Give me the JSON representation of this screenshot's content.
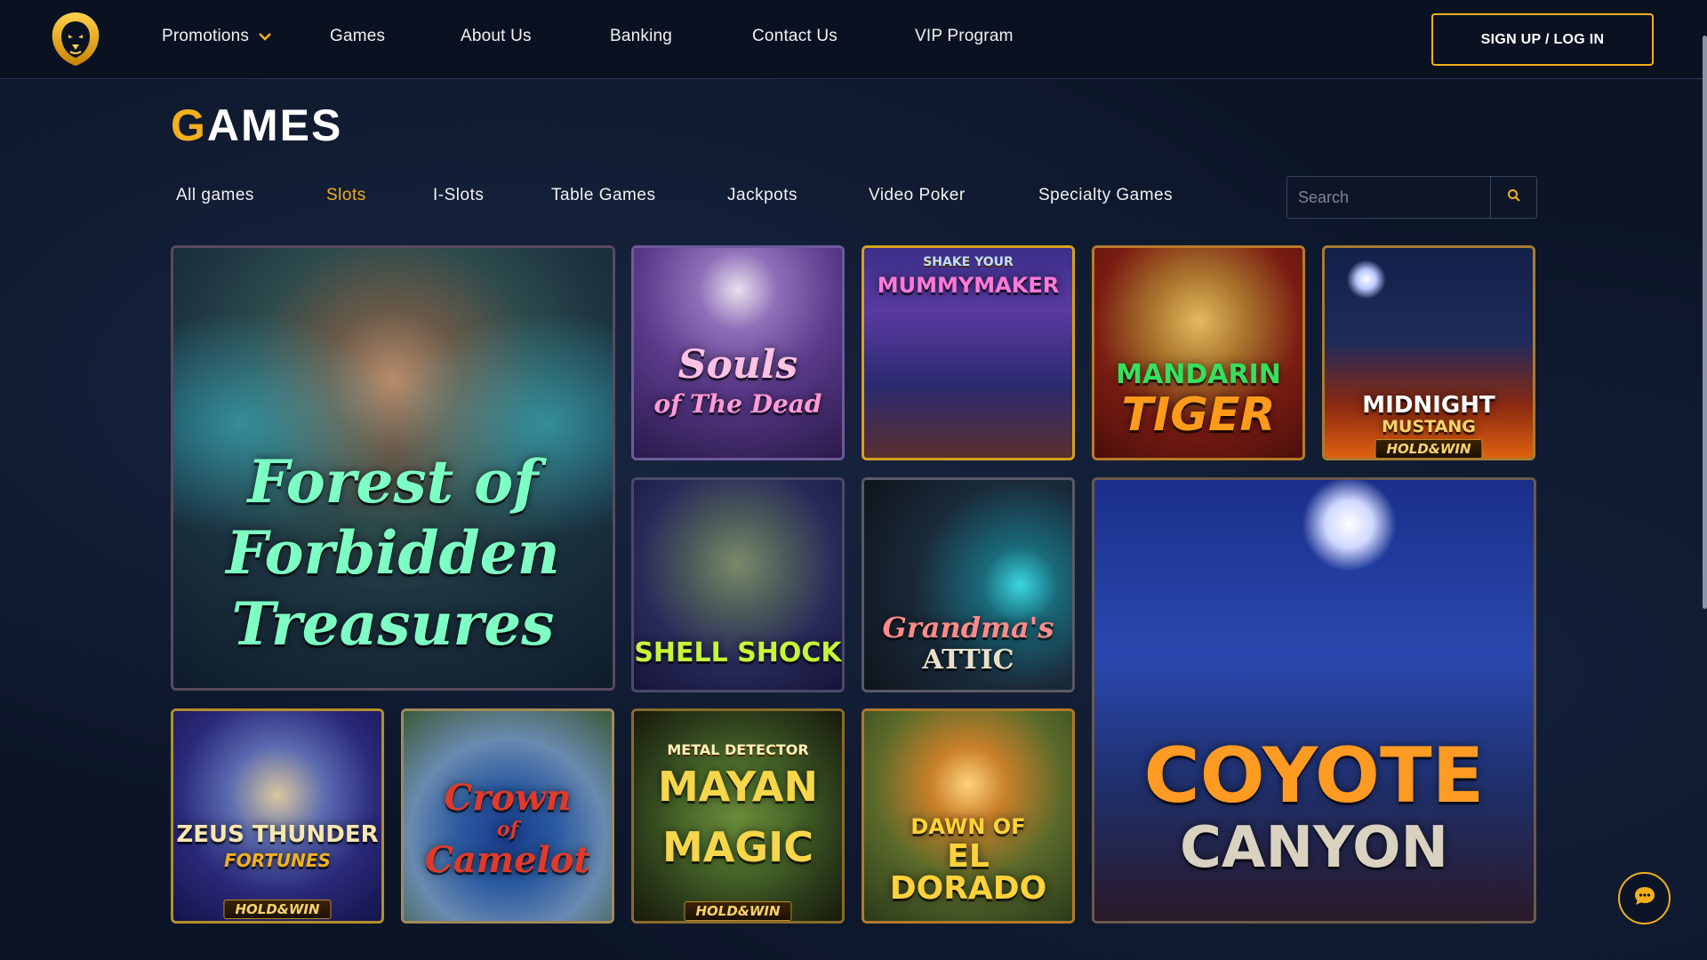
{
  "header": {
    "nav": [
      {
        "label": "Promotions",
        "has_dropdown": true
      },
      {
        "label": "Games"
      },
      {
        "label": "About Us"
      },
      {
        "label": "Banking"
      },
      {
        "label": "Contact Us"
      },
      {
        "label": "VIP Program"
      }
    ],
    "signup_label": "SIGN UP / LOG IN"
  },
  "page": {
    "title_first": "G",
    "title_rest": "AMES"
  },
  "tabs": [
    {
      "label": "All games",
      "active": false
    },
    {
      "label": "Slots",
      "active": true
    },
    {
      "label": "I-Slots",
      "active": false
    },
    {
      "label": "Table Games",
      "active": false
    },
    {
      "label": "Jackpots",
      "active": false
    },
    {
      "label": "Video Poker",
      "active": false
    },
    {
      "label": "Specialty Games",
      "active": false
    }
  ],
  "search": {
    "placeholder": "Search",
    "value": ""
  },
  "games": [
    {
      "name_l1": "Forest of",
      "name_l2": "Forbidden",
      "name_l3": "Treasures"
    },
    {
      "name_l1": "Souls",
      "name_l2": "of The Dead"
    },
    {
      "top": "SHAKE YOUR",
      "name_l1": "MUMMYMAKER"
    },
    {
      "name_l1": "MANDARIN",
      "name_l2": "TIGER"
    },
    {
      "name_l1": "MIDNIGHT",
      "name_l2": "MUSTANG",
      "badge": "HOLD&WIN"
    },
    {
      "name_l1": "SHELL SHOCK"
    },
    {
      "name_l1": "Grandma's",
      "name_l2": "ATTIC"
    },
    {
      "name_l1": "COYOTE",
      "name_l2": "CANYON"
    },
    {
      "name_l1": "ZEUS THUNDER",
      "name_l2": "FORTUNES",
      "badge": "HOLD&WIN"
    },
    {
      "name_l1": "Crown",
      "name_l2": "of",
      "name_l3": "Camelot"
    },
    {
      "top": "METAL DETECTOR",
      "name_l1": "MAYAN",
      "name_l2": "MAGIC",
      "badge": "HOLD&WIN"
    },
    {
      "name_l1": "DAWN OF",
      "name_l2": "EL DORADO"
    }
  ],
  "colors": {
    "accent": "#f2b01e",
    "background": "#0c1528",
    "header_bg": "#0a1222",
    "text": "#ffffff"
  },
  "icons": {
    "logo": "lion-logo-icon",
    "search": "search-icon",
    "chat": "chat-icon",
    "dropdown": "chevron-down-icon"
  }
}
